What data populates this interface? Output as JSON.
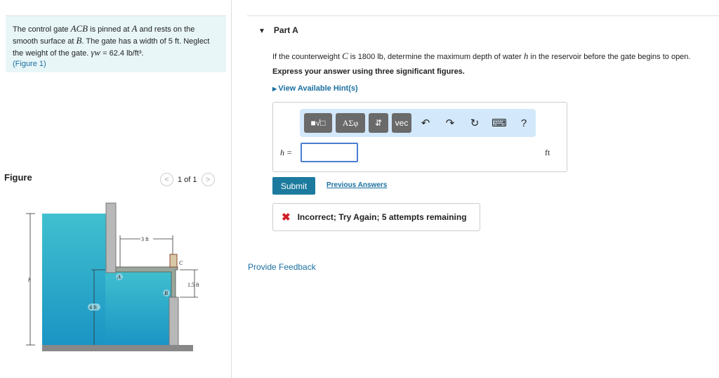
{
  "problem": {
    "t1": "The control gate ",
    "acb": "ACB",
    "t2": " is pinned at ",
    "a": "A",
    "t3": " and rests on the smooth surface at ",
    "b": "B",
    "t4": ". The gate has a width of 5 ",
    "ft": "ft",
    "t5": ". Neglect the weight of the gate. ",
    "gamma": "γw",
    "t6": " = 62.4 ",
    "unit": "lb/ft³",
    "t7": ".",
    "figure_link": "(Figure 1)"
  },
  "figure": {
    "title": "Figure",
    "pager": "1 of 1",
    "labels": {
      "h": "h",
      "dim3": "3 ft",
      "dim15": "1.5 ft",
      "dim4": "4 ft",
      "A": "A",
      "B": "B",
      "C": "C"
    }
  },
  "part": {
    "title": "Part A",
    "q1": "If the counterweight ",
    "c": "C",
    "q2": " is 1800 ",
    "lb": "lb",
    "q3": ", determine the maximum depth of water ",
    "h": "h",
    "q4": " in the reservoir before the gate begins to open.",
    "instruction": "Express your answer using three significant figures.",
    "hint": "View Available Hint(s)"
  },
  "answer": {
    "label": "h =",
    "unit": "ft",
    "value": "",
    "toolbar": {
      "templates": "■√□",
      "greek": "ΑΣφ",
      "arrows": "⇵",
      "vec": "vec",
      "help": "?"
    }
  },
  "submit": "Submit",
  "previous": "Previous Answers",
  "feedback_msg": "Incorrect; Try Again; 5 attempts remaining",
  "provide_feedback": "Provide Feedback"
}
